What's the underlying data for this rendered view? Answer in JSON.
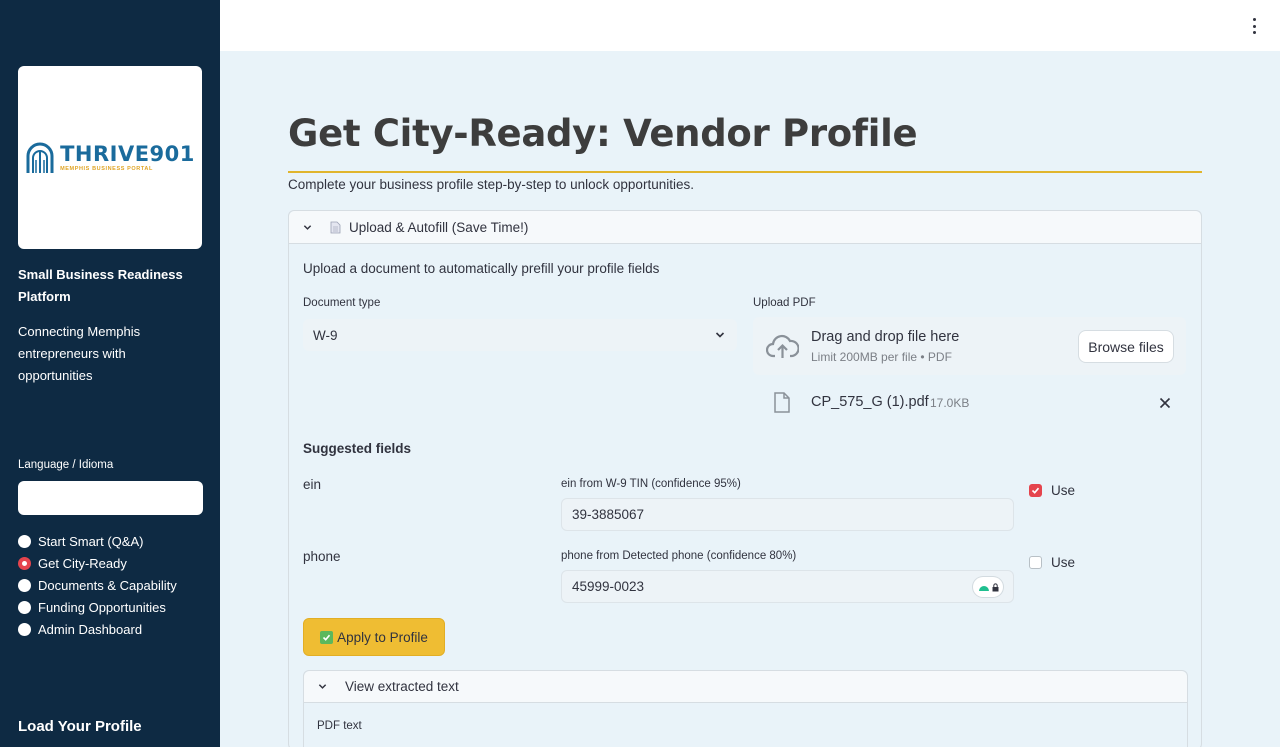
{
  "sidebar": {
    "logo": {
      "main": "THRIVE901",
      "sub": "MEMPHIS BUSINESS PORTAL"
    },
    "title": "Small Business Readiness Platform",
    "description": "Connecting Memphis entrepreneurs with opportunities",
    "language_label": "Language / Idioma",
    "language_value": "",
    "nav": [
      {
        "label": "Start Smart (Q&A)",
        "active": false
      },
      {
        "label": "Get City-Ready",
        "active": true
      },
      {
        "label": "Documents & Capability",
        "active": false
      },
      {
        "label": "Funding Opportunities",
        "active": false
      },
      {
        "label": "Admin Dashboard",
        "active": false
      }
    ],
    "load_profile": "Load Your Profile"
  },
  "page": {
    "title": "Get City-Ready: Vendor Profile",
    "subtitle": "Complete your business profile step-by-step to unlock opportunities."
  },
  "upload": {
    "expander_label": "Upload & Autofill (Save Time!)",
    "description": "Upload a document to automatically prefill your profile fields",
    "doc_type_label": "Document type",
    "doc_type_value": "W-9",
    "upload_label": "Upload PDF",
    "drop_title": "Drag and drop file here",
    "drop_sub": "Limit 200MB per file • PDF",
    "browse_label": "Browse files",
    "file": {
      "name": "CP_575_G (1).pdf",
      "size": "17.0KB"
    }
  },
  "suggested": {
    "heading": "Suggested fields",
    "fields": [
      {
        "name": "ein",
        "source": "ein from W-9 TIN (confidence 95%)",
        "value": "39-3885067",
        "use": true,
        "use_label": "Use"
      },
      {
        "name": "phone",
        "source": "phone from Detected phone (confidence 80%)",
        "value": "45999-0023",
        "use": false,
        "use_label": "Use"
      }
    ]
  },
  "apply_label": "Apply to Profile",
  "extracted": {
    "expander_label": "View extracted text",
    "pdf_label": "PDF text"
  },
  "colors": {
    "sidebar_bg": "#0e2a43",
    "accent_red": "#e5444d",
    "accent_gold": "#efbd33",
    "brand_blue": "#1a6b9c"
  }
}
